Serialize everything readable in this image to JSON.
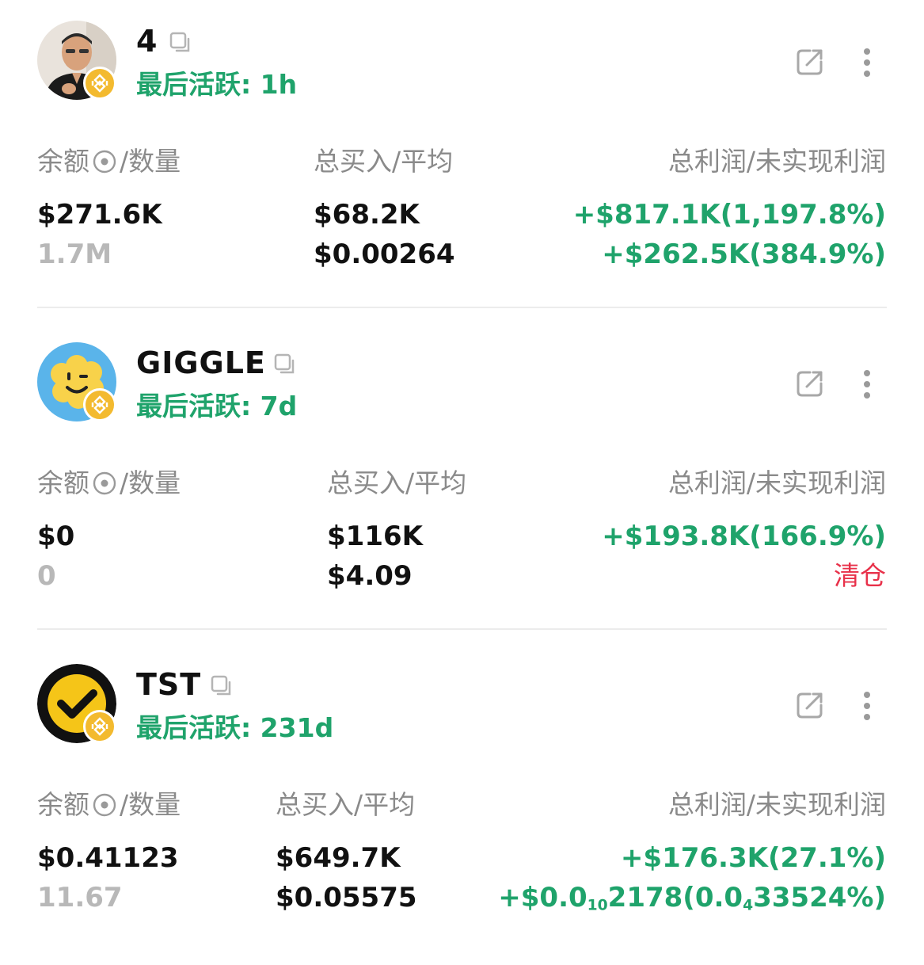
{
  "columns": {
    "balance_label_a": "余额",
    "balance_label_b": "/数量",
    "buy_label": "总买入/平均",
    "profit_label": "总利润/未实现利润"
  },
  "colors": {
    "profit": "#1fa36b",
    "loss_tag": "#e8314a",
    "muted": "#b8b8b8",
    "header": "#8a8a8a",
    "badge": "#f3ba2f"
  },
  "tokens": [
    {
      "name": "4",
      "last_active": "最后活跃: 1h",
      "balance": "$271.6K",
      "quantity": "1.7M",
      "total_buy": "$68.2K",
      "avg_price": "$0.00264",
      "total_profit": "+$817.1K(1,197.8%)",
      "unrealized_profit": "+$262.5K(384.9%)",
      "avatar_icon": "person-avatar",
      "chain_icon": "bnb-chain-icon"
    },
    {
      "name": "GIGGLE",
      "last_active": "最后活跃: 7d",
      "balance": "$0",
      "quantity": "0",
      "total_buy": "$116K",
      "avg_price": "$4.09",
      "total_profit": "+$193.8K(166.9%)",
      "unrealized_profit": "清仓",
      "avatar_icon": "smiley-flower-icon",
      "chain_icon": "bnb-chain-icon"
    },
    {
      "name": "TST",
      "last_active": "最后活跃: 231d",
      "balance": "$0.41123",
      "quantity": "11.67",
      "total_buy": "$649.7K",
      "avg_price": "$0.05575",
      "total_profit": "+$176.3K(27.1%)",
      "unrealized_profit": {
        "prefix": "+$0.0",
        "sub1": "10",
        "mid": "2178(0.0",
        "sub2": "4",
        "suffix": "33524%)"
      },
      "avatar_icon": "checkmark-icon",
      "chain_icon": "bnb-chain-icon"
    }
  ]
}
